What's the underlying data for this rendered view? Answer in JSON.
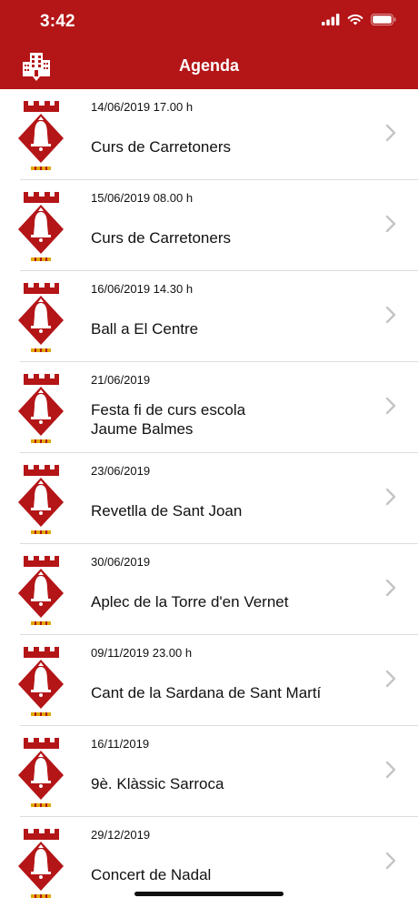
{
  "status_bar": {
    "time": "3:42"
  },
  "nav": {
    "title": "Agenda",
    "left_icon": "buildings-icon"
  },
  "colors": {
    "brand_red": "#b41517",
    "separator": "#dcdcdc",
    "chevron": "#c4c4c7"
  },
  "events": [
    {
      "date": "14/06/2019 17.00 h",
      "title": "Curs de Carretoners"
    },
    {
      "date": "15/06/2019 08.00 h",
      "title": "Curs de Carretoners"
    },
    {
      "date": "16/06/2019 14.30 h",
      "title": "Ball a El Centre"
    },
    {
      "date": "21/06/2019",
      "title": "Festa fi de curs escola\nJaume Balmes"
    },
    {
      "date": "23/06/2019",
      "title": "Revetlla de Sant Joan"
    },
    {
      "date": "30/06/2019",
      "title": "Aplec de la Torre d'en Vernet"
    },
    {
      "date": "09/11/2019 23.00 h",
      "title": "Cant de la Sardana de Sant Martí"
    },
    {
      "date": "16/11/2019",
      "title": "9è. Klàssic Sarroca"
    },
    {
      "date": "29/12/2019",
      "title": "Concert de Nadal"
    }
  ]
}
